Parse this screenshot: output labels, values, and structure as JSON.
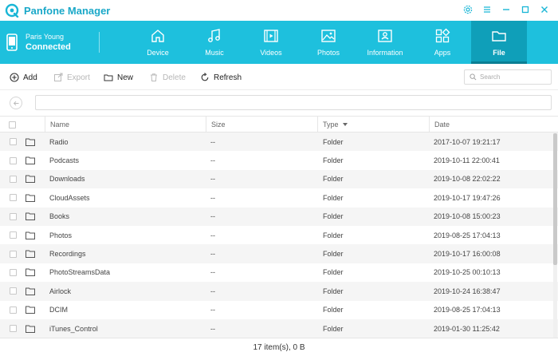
{
  "app": {
    "title": "Panfone Manager"
  },
  "device": {
    "name": "Paris Young",
    "status": "Connected"
  },
  "nav": {
    "tabs": [
      {
        "label": "Device"
      },
      {
        "label": "Music"
      },
      {
        "label": "Videos"
      },
      {
        "label": "Photos"
      },
      {
        "label": "Information"
      },
      {
        "label": "Apps"
      },
      {
        "label": "File",
        "active": true
      }
    ]
  },
  "toolbar": {
    "add": "Add",
    "export": "Export",
    "new": "New",
    "delete": "Delete",
    "refresh": "Refresh",
    "search_placeholder": "Search"
  },
  "path": {
    "value": ""
  },
  "table": {
    "columns": {
      "name": "Name",
      "size": "Size",
      "type": "Type",
      "date": "Date"
    },
    "rows": [
      {
        "name": "Radio",
        "size": "--",
        "type": "Folder",
        "date": "2017-10-07 19:21:17"
      },
      {
        "name": "Podcasts",
        "size": "--",
        "type": "Folder",
        "date": "2019-10-11 22:00:41"
      },
      {
        "name": "Downloads",
        "size": "--",
        "type": "Folder",
        "date": "2019-10-08 22:02:22"
      },
      {
        "name": "CloudAssets",
        "size": "--",
        "type": "Folder",
        "date": "2019-10-17 19:47:26"
      },
      {
        "name": "Books",
        "size": "--",
        "type": "Folder",
        "date": "2019-10-08 15:00:23"
      },
      {
        "name": "Photos",
        "size": "--",
        "type": "Folder",
        "date": "2019-08-25 17:04:13"
      },
      {
        "name": "Recordings",
        "size": "--",
        "type": "Folder",
        "date": "2019-10-17 16:00:08"
      },
      {
        "name": "PhotoStreamsData",
        "size": "--",
        "type": "Folder",
        "date": "2019-10-25 00:10:13"
      },
      {
        "name": "Airlock",
        "size": "--",
        "type": "Folder",
        "date": "2019-10-24 16:38:47"
      },
      {
        "name": "DCIM",
        "size": "--",
        "type": "Folder",
        "date": "2019-08-25 17:04:13"
      },
      {
        "name": "iTunes_Control",
        "size": "--",
        "type": "Folder",
        "date": "2019-01-30 11:25:42"
      }
    ]
  },
  "footer": {
    "summary": "17 item(s), 0 B"
  },
  "colors": {
    "accent": "#1ec0dd",
    "active_tab": "#0f9fb9"
  }
}
